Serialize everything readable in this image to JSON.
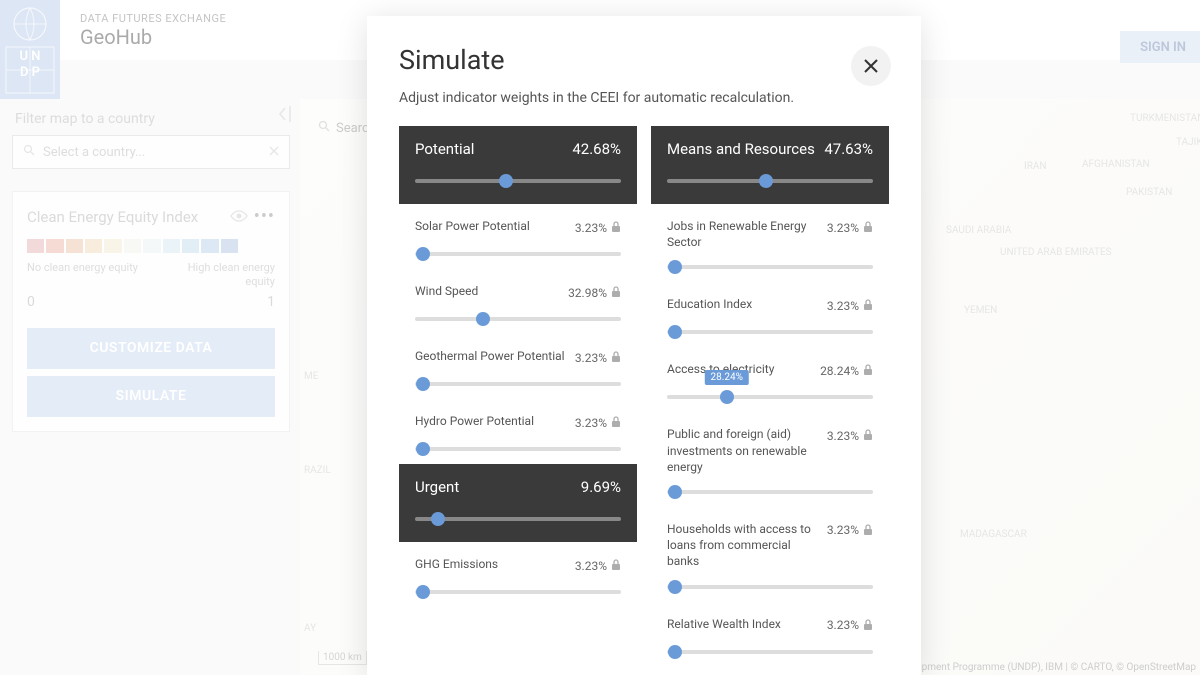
{
  "header": {
    "subtitle": "DATA FUTURES EXCHANGE",
    "title": "GeoHub",
    "sign_in": "SIGN IN"
  },
  "sidebar": {
    "filter_label": "Filter map to a country",
    "country_placeholder": "Select a country...",
    "ceei_title": "Clean Energy Equity Index",
    "legend_low": "No clean energy equity",
    "legend_high": "High clean energy equity",
    "legend_min": "0",
    "legend_max": "1",
    "customize_btn": "CUSTOMIZE DATA",
    "simulate_btn": "SIMULATE"
  },
  "map": {
    "search_placeholder": "Search",
    "scale": "1000 km",
    "attribution": "United Nations Development Programme (UNDP), IBM | © CARTO, © OpenStreetMap",
    "labels": {
      "turkmenistan": "TURKMENISTAN",
      "tajikistan": "TAJIKISTAN",
      "iran": "IRAN",
      "afghanistan": "AFGHANISTAN",
      "pakistan": "PAKISTAN",
      "saudi": "SAUDI ARABIA",
      "uae": "UNITED ARAB EMIRATES",
      "yemen": "YEMEN",
      "madagascar": "MADAGASCAR",
      "brazil": "RAZIL",
      "me": "ME",
      "ay": "AY"
    }
  },
  "modal": {
    "title": "Simulate",
    "subtitle": "Adjust indicator weights in the CEEI for automatic recalculation.",
    "tooltip_val": "28.24%",
    "left_col": [
      {
        "type": "group",
        "name": "Potential",
        "value": "42.68%",
        "pos": 44
      },
      {
        "type": "ind",
        "name": "Solar Power Potential",
        "value": "3.23%",
        "pos": 4
      },
      {
        "type": "ind",
        "name": "Wind Speed",
        "value": "32.98%",
        "pos": 33
      },
      {
        "type": "ind",
        "name": "Geothermal Power Potential",
        "value": "3.23%",
        "pos": 4
      },
      {
        "type": "ind",
        "name": "Hydro Power Potential",
        "value": "3.23%",
        "pos": 4
      },
      {
        "type": "group",
        "name": "Urgent",
        "value": "9.69%",
        "pos": 11
      },
      {
        "type": "ind",
        "name": "GHG Emissions",
        "value": "3.23%",
        "pos": 4
      }
    ],
    "right_col": [
      {
        "type": "group",
        "name": "Means and Resources",
        "value": "47.63%",
        "pos": 48
      },
      {
        "type": "ind",
        "name": "Jobs in Renewable Energy Sector",
        "value": "3.23%",
        "pos": 4
      },
      {
        "type": "ind",
        "name": "Education Index",
        "value": "3.23%",
        "pos": 4
      },
      {
        "type": "ind",
        "name": "Access to electricity",
        "value": "28.24%",
        "pos": 29,
        "tooltip": true
      },
      {
        "type": "ind",
        "name": "Public and foreign (aid) investments on renewable energy",
        "value": "3.23%",
        "pos": 4
      },
      {
        "type": "ind",
        "name": "Households with access to loans from commercial banks",
        "value": "3.23%",
        "pos": 4
      },
      {
        "type": "ind",
        "name": "Relative Wealth Index",
        "value": "3.23%",
        "pos": 4
      }
    ]
  }
}
